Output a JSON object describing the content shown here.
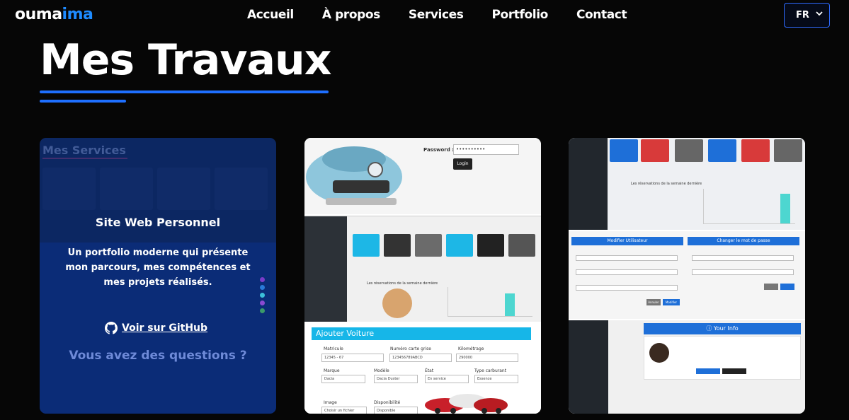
{
  "nav": {
    "logo_part1": "ouma",
    "logo_part2": "ima",
    "links": [
      "Accueil",
      "À propos",
      "Services",
      "Portfolio",
      "Contact"
    ],
    "lang": "FR"
  },
  "page": {
    "title": "Mes Travaux"
  },
  "card1": {
    "bg_title": "Mes Services",
    "title": "Site Web Personnel",
    "description": "Un portfolio moderne qui présente mon parcours, mes compétences et mes projets réalisés.",
    "link_label": "Voir sur GitHub",
    "bg_question": "Vous avez des questions ?"
  },
  "card2": {
    "password_label": "Password :",
    "password_value": "••••••••••",
    "login_label": "Login",
    "chart_title": "Les réservations de la semaine dernière",
    "form_header": "Ajouter Voiture",
    "fields": [
      {
        "label": "Matricule",
        "value": "12345 - 67"
      },
      {
        "label": "Numéro carte grise",
        "value": "123456789ABCD"
      },
      {
        "label": "Kilométrage",
        "value": "290000"
      },
      {
        "label": "Marque",
        "value": "Dacia"
      },
      {
        "label": "Modèle",
        "value": "Dacia Duster"
      },
      {
        "label": "État",
        "value": "En service"
      },
      {
        "label": "Type carburant",
        "value": "Essence"
      },
      {
        "label": "Image",
        "value": "Choisir un fichier"
      },
      {
        "label": "Disponibilité",
        "value": "Disponible"
      }
    ]
  },
  "card3": {
    "chart_title": "Les réservations de la semaine dernière",
    "modify_user": "Modifier Utilisateur",
    "change_password": "Changer le mot de passe",
    "your_info": "Your Info",
    "btn_modifier": "Modifier",
    "btn_annuler": "Annuler"
  },
  "colors": {
    "accent": "#1e6fff",
    "logo_accent": "#1e8bff",
    "background": "#060606"
  }
}
